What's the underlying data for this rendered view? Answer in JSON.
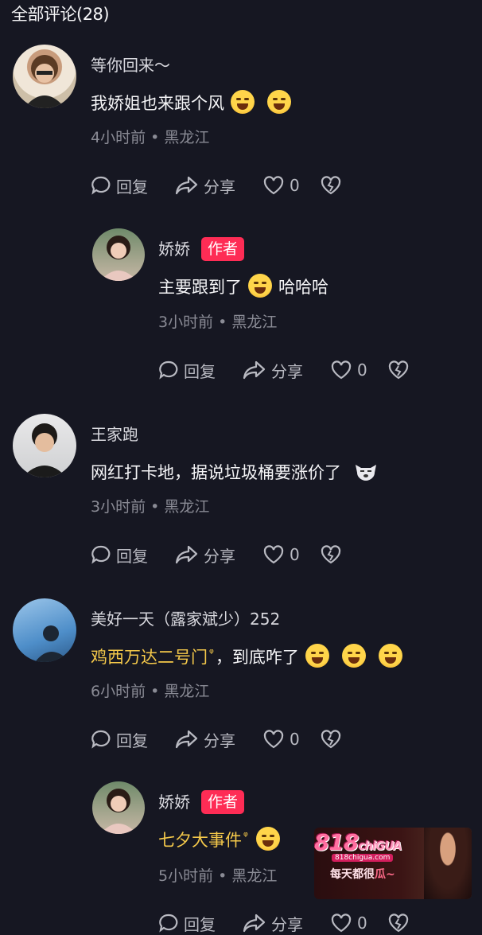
{
  "header": {
    "title": "全部评论(28)"
  },
  "comments": [
    {
      "name": "等你回来～",
      "text": "我娇姐也来跟个风",
      "emojis": [
        "laughing-emoji",
        "laughing-emoji"
      ],
      "time": "4小时前",
      "location": "黑龙江",
      "reply": "回复",
      "share": "分享",
      "likes": "0"
    },
    {
      "name": "娇娇",
      "tag": "作者",
      "text_before": "主要跟到了",
      "text_after": "哈哈哈",
      "time": "3小时前",
      "location": "黑龙江",
      "reply": "回复",
      "share": "分享",
      "likes": "0"
    },
    {
      "name": "王家跑",
      "text": "网红打卡地，据说垃圾桶要涨价了",
      "time": "3小时前",
      "location": "黑龙江",
      "reply": "回复",
      "share": "分享",
      "likes": "0"
    },
    {
      "name": "美好一天（露家斌少）252",
      "link": "鸡西万达二号门",
      "text": "，到底咋了",
      "time": "6小时前",
      "location": "黑龙江",
      "reply": "回复",
      "share": "分享",
      "likes": "0"
    },
    {
      "name": "娇娇",
      "tag": "作者",
      "link": "七夕大事件",
      "time": "5小时前",
      "location": "黑龙江",
      "reply": "回复",
      "share": "分享",
      "likes": "0"
    }
  ],
  "ad": {
    "logo_num": "818",
    "logo_text": "chiGUA",
    "url": "818chigua.com",
    "slogan_a": "每天都很",
    "slogan_b": "瓜~"
  },
  "separator": "•",
  "colors": {
    "background": "#161722",
    "tag": "#fe2c55",
    "link": "#f5c94a",
    "meta": "#8a8b95"
  }
}
